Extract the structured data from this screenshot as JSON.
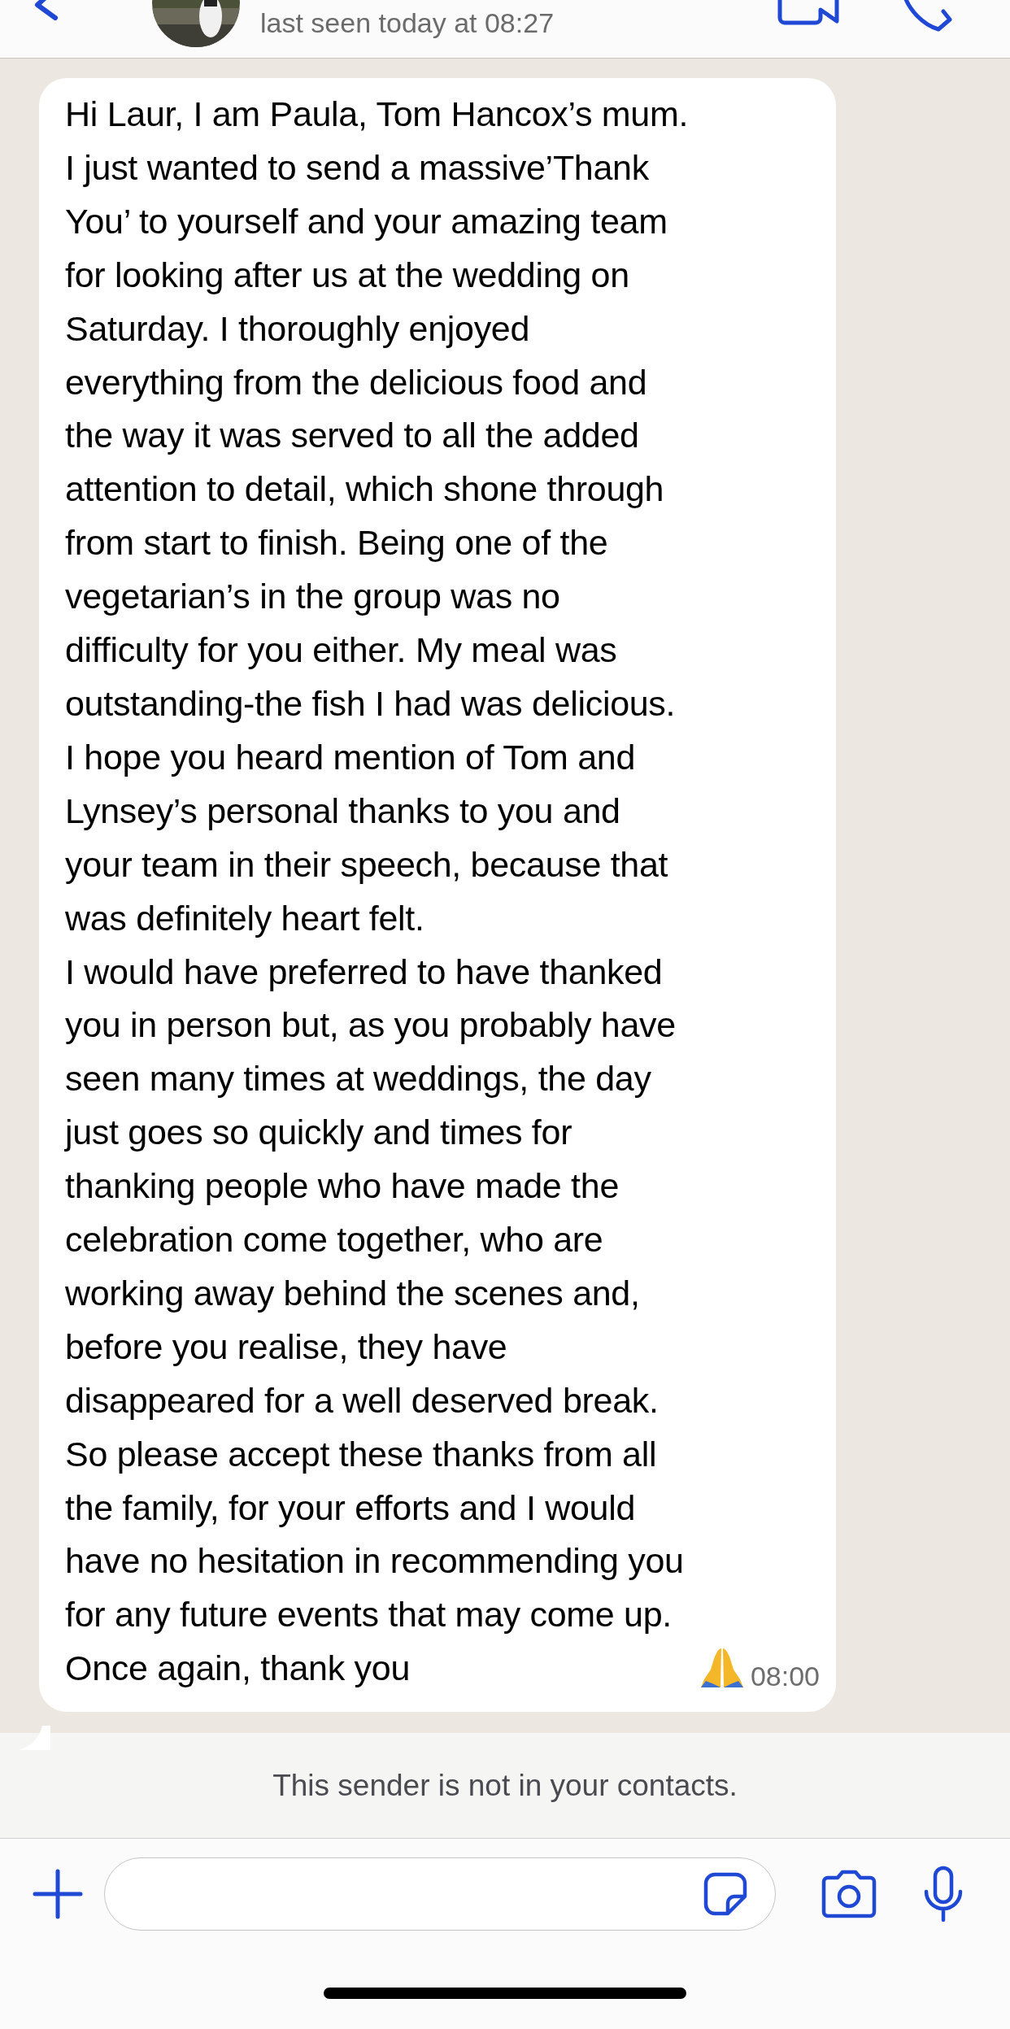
{
  "header": {
    "status": "last seen today at 08:27"
  },
  "message": {
    "text": "Hi Laur, I am Paula, Tom Hancox’s mum.\nI just wanted to send a massive’Thank\nYou’ to yourself and your amazing team\nfor looking after us at the wedding on\nSaturday. I thoroughly enjoyed\neverything from the delicious food and\nthe way it was served to all the added\nattention to detail, which shone through\nfrom start to finish. Being one of the\nvegetarian’s in the group was no\ndifficulty for you either. My meal was\noutstanding-the fish I had was delicious.\nI hope you heard mention of Tom and\nLynsey’s personal thanks to you and\nyour team in their speech, because that\nwas definitely heart felt.\nI would have preferred to have thanked\nyou in person but, as you probably have\nseen many times at weddings, the day\njust goes so quickly and times for\nthanking people who have made the\ncelebration come together, who are\nworking away behind the scenes and,\nbefore you realise, they have\ndisappeared for a well deserved break.\nSo please accept these thanks from all\nthe family, for your efforts and I would\nhave no hesitation in recommending you\nfor any future events that may come up.\nOnce again, thank you",
    "time": "08:00"
  },
  "notice": "This sender is not in your contacts."
}
